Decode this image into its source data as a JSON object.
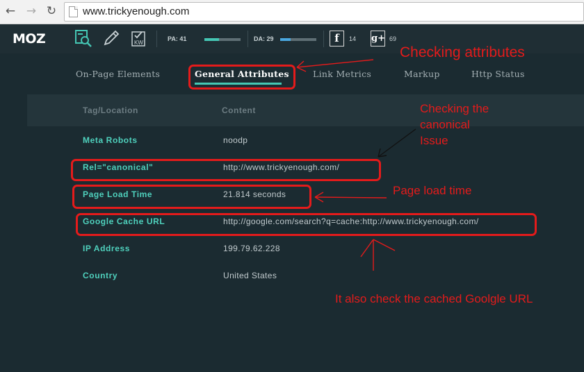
{
  "browser": {
    "back_glyph": "←",
    "forward_glyph": "→",
    "reload_glyph": "↻",
    "url": "www.trickyenough.com"
  },
  "mozbar": {
    "logo": "MOZ",
    "tools": [
      "analyze-page-icon",
      "edit-icon",
      "keyword-icon"
    ],
    "kw_icon_text": "KW",
    "pa": {
      "label": "PA: 41",
      "value": 41
    },
    "da": {
      "label": "DA: 29",
      "value": 29
    },
    "facebook": {
      "glyph": "f",
      "count": "14"
    },
    "googleplus": {
      "glyph": "g+",
      "count": "69"
    },
    "colors": {
      "pa_bar": "#45c7b4",
      "da_bar": "#4aa8e0"
    }
  },
  "tabs": [
    {
      "label": "On-Page Elements"
    },
    {
      "label": "General Attributes",
      "active": true
    },
    {
      "label": "Link Metrics"
    },
    {
      "label": "Markup"
    },
    {
      "label": "Http Status"
    }
  ],
  "table": {
    "headers": [
      "Tag/Location",
      "Content"
    ],
    "rows": [
      {
        "label": "Meta Robots",
        "value": "noodp"
      },
      {
        "label": "Rel=\"canonical\"",
        "value": "http://www.trickyenough.com/"
      },
      {
        "label": "Page Load Time",
        "value": "21.814 seconds"
      },
      {
        "label": "Google Cache URL",
        "value": "http://google.com/search?q=cache:http://www.trickyenough.com/"
      },
      {
        "label": "IP Address",
        "value": "199.79.62.228"
      },
      {
        "label": "Country",
        "value": "United States"
      }
    ]
  },
  "annotations": {
    "checking_attributes": "Checking attributes",
    "canonical_line1": "Checking the",
    "canonical_line2": "canonical",
    "canonical_line3": "Issue",
    "page_load": "Page load time",
    "cache": "It also check the cached Goolgle URL",
    "color": "#e41b1b"
  }
}
